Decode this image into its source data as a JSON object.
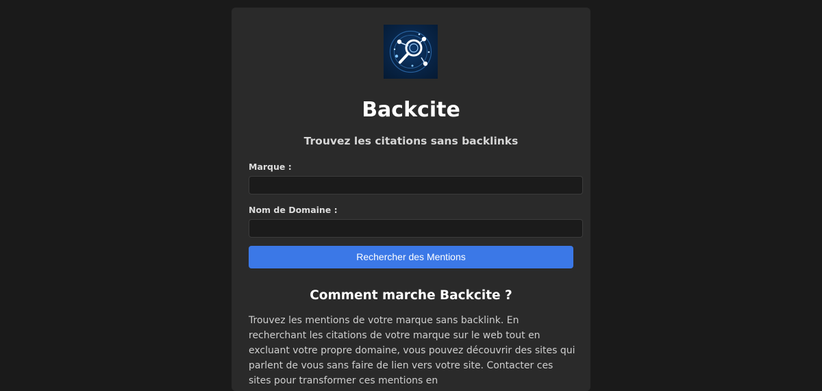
{
  "app": {
    "title": "Backcite",
    "tagline": "Trouvez les citations sans backlinks",
    "logo_icon": "magnifier-network-icon"
  },
  "form": {
    "brand_label": "Marque :",
    "brand_value": "",
    "domain_label": "Nom de Domaine :",
    "domain_value": "",
    "submit_label": "Rechercher des Mentions"
  },
  "info": {
    "heading": "Comment marche Backcite ?",
    "body": "Trouvez les mentions de votre marque sans backlink. En recherchant les citations de votre marque sur le web tout en excluant votre propre domaine, vous pouvez découvrir des sites qui parlent de vous sans faire de lien vers votre site. Contacter ces sites pour transformer ces mentions en"
  },
  "colors": {
    "page_bg": "#1a1a1a",
    "card_bg": "#2a2a2a",
    "accent": "#3b78e7"
  }
}
